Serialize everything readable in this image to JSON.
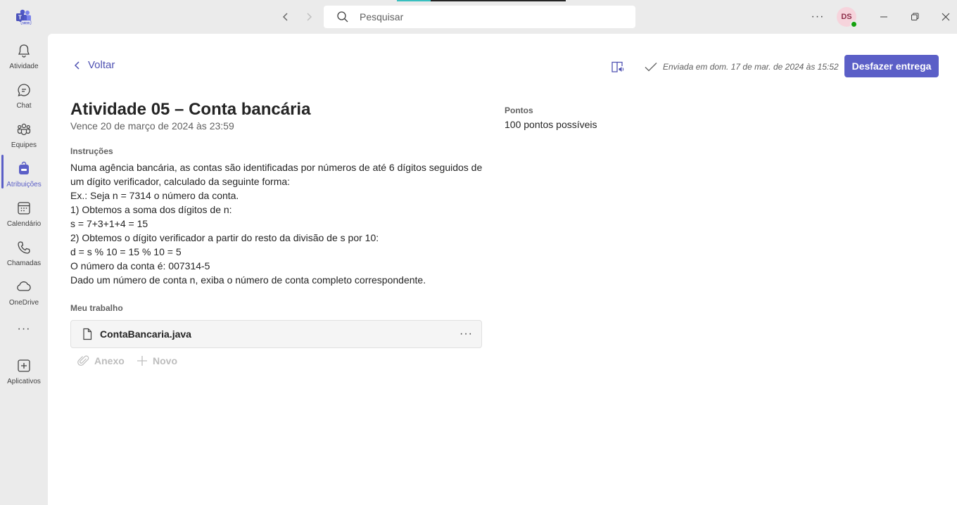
{
  "titlebar": {
    "logo_badge": "NEW",
    "search_placeholder": "Pesquisar",
    "more_label": "···",
    "avatar_initials": "DS"
  },
  "rail": {
    "items": [
      {
        "label": "Atividade",
        "icon": "bell-icon"
      },
      {
        "label": "Chat",
        "icon": "chat-icon"
      },
      {
        "label": "Equipes",
        "icon": "teams-icon"
      },
      {
        "label": "Atribuições",
        "icon": "backpack-icon"
      },
      {
        "label": "Calendário",
        "icon": "calendar-icon"
      },
      {
        "label": "Chamadas",
        "icon": "phone-icon"
      },
      {
        "label": "OneDrive",
        "icon": "cloud-icon"
      },
      {
        "label": "Aplicativos",
        "icon": "add-app-icon"
      }
    ],
    "more_label": "···",
    "active_index": 3
  },
  "assignment": {
    "back_label": "Voltar",
    "sent_text": "Enviada em dom. 17 de mar. de 2024 às 15:52",
    "undo_button": "Desfazer entrega",
    "title": "Atividade 05 – Conta bancária",
    "due": "Vence 20 de março de 2024 às 23:59",
    "instructions_label": "Instruções",
    "instructions": [
      "Numa agência bancária, as contas são identificadas por números de até 6 dígitos seguidos de",
      "um dígito verificador, calculado da seguinte forma:",
      "Ex.: Seja n = 7314 o número da conta.",
      "1) Obtemos a soma dos dígitos de n:",
      "s = 7+3+1+4 = 15",
      "2) Obtemos o dígito verificador a partir do resto da divisão de s por 10:",
      "d = s % 10 = 15 % 10 = 5",
      "O número da conta é: 007314-5",
      "Dado um número de conta n, exiba o número de conta completo correspondente."
    ],
    "points_label": "Pontos",
    "points_value": "100 pontos possíveis",
    "work_label": "Meu trabalho",
    "file_name": "ContaBancaria.java",
    "file_more": "···",
    "attach_label": "Anexo",
    "new_label": "Novo"
  },
  "colors": {
    "accent": "#5b5fc7",
    "link": "#4f52b2",
    "presence": "#13a10e"
  }
}
